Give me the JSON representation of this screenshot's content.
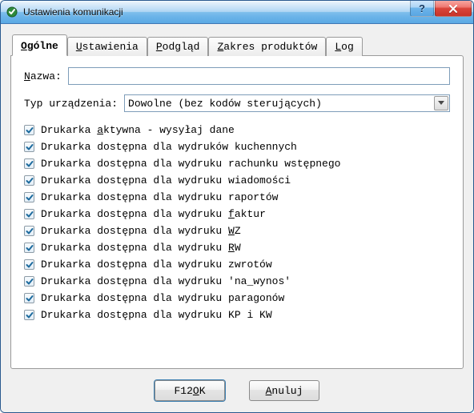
{
  "window": {
    "title": "Ustawienia komunikacji"
  },
  "tabs": {
    "ogolne": {
      "pre": "",
      "u": "O",
      "post": "gólne"
    },
    "ustaw": {
      "pre": "",
      "u": "U",
      "post": "stawienia"
    },
    "podg": {
      "pre": "",
      "u": "P",
      "post": "odgląd"
    },
    "zakres": {
      "pre": "",
      "u": "Z",
      "post": "akres produktów"
    },
    "log": {
      "pre": "",
      "u": "L",
      "post": "og"
    }
  },
  "fields": {
    "name_label": {
      "pre": "",
      "u": "N",
      "post": "azwa:"
    },
    "name_value": "",
    "type_label": "Typ urządzenia:",
    "type_value": "Dowolne (bez kodów sterujących)"
  },
  "checks": [
    {
      "checked": true,
      "pre": "Drukarka ",
      "u": "a",
      "post": "ktywna - wysyłaj dane"
    },
    {
      "checked": true,
      "pre": "Drukarka dostępna dla wydruków kuchennych",
      "u": "",
      "post": ""
    },
    {
      "checked": true,
      "pre": "Drukarka dostępna dla wydruku rachunku wstępnego",
      "u": "",
      "post": ""
    },
    {
      "checked": true,
      "pre": "Drukarka dostępna dla wydruku wiadomości",
      "u": "",
      "post": ""
    },
    {
      "checked": true,
      "pre": "Drukarka dostępna dla wydruku raportów",
      "u": "",
      "post": ""
    },
    {
      "checked": true,
      "pre": "Drukarka dostępna dla wydruku ",
      "u": "f",
      "post": "aktur"
    },
    {
      "checked": true,
      "pre": "Drukarka dostępna dla wydruku ",
      "u": "W",
      "post": "Z"
    },
    {
      "checked": true,
      "pre": "Drukarka dostępna dla wydruku ",
      "u": "R",
      "post": "W"
    },
    {
      "checked": true,
      "pre": "Drukarka dostępna dla wydruku zwrotów",
      "u": "",
      "post": ""
    },
    {
      "checked": true,
      "pre": "Drukarka dostępna dla wydruku 'na_wynos'",
      "u": "",
      "post": ""
    },
    {
      "checked": true,
      "pre": "Drukarka dostępna dla wydruku paragonów",
      "u": "",
      "post": ""
    },
    {
      "checked": true,
      "pre": "Drukarka dostępna dla wydruku KP i KW",
      "u": "",
      "post": ""
    }
  ],
  "buttons": {
    "ok": {
      "pre": "F12 ",
      "u": "O",
      "post": "K"
    },
    "cancel": {
      "pre": "",
      "u": "A",
      "post": "nuluj"
    }
  }
}
